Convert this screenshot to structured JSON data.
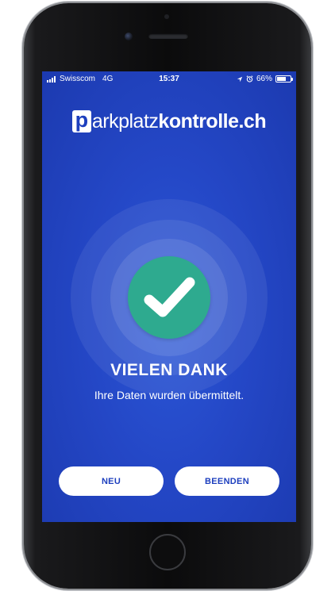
{
  "status_bar": {
    "carrier": "Swisscom",
    "network": "4G",
    "time": "15:37",
    "battery_percent": "66%",
    "battery_level": 0.66,
    "icons": [
      "signal-icon",
      "location-icon",
      "alarm-icon",
      "battery-icon"
    ]
  },
  "logo": {
    "letter": "p",
    "light": "arkplatz",
    "bold": "kontrolle.ch"
  },
  "confirmation": {
    "icon": "checkmark-icon",
    "title": "VIELEN DANK",
    "message": "Ihre Daten wurden übermittelt."
  },
  "buttons": {
    "new_label": "NEU",
    "finish_label": "BEENDEN"
  },
  "colors": {
    "background": "#2447c6",
    "check_circle": "#2eaa8f",
    "button_bg": "#ffffff",
    "button_text": "#1d3fbe"
  }
}
